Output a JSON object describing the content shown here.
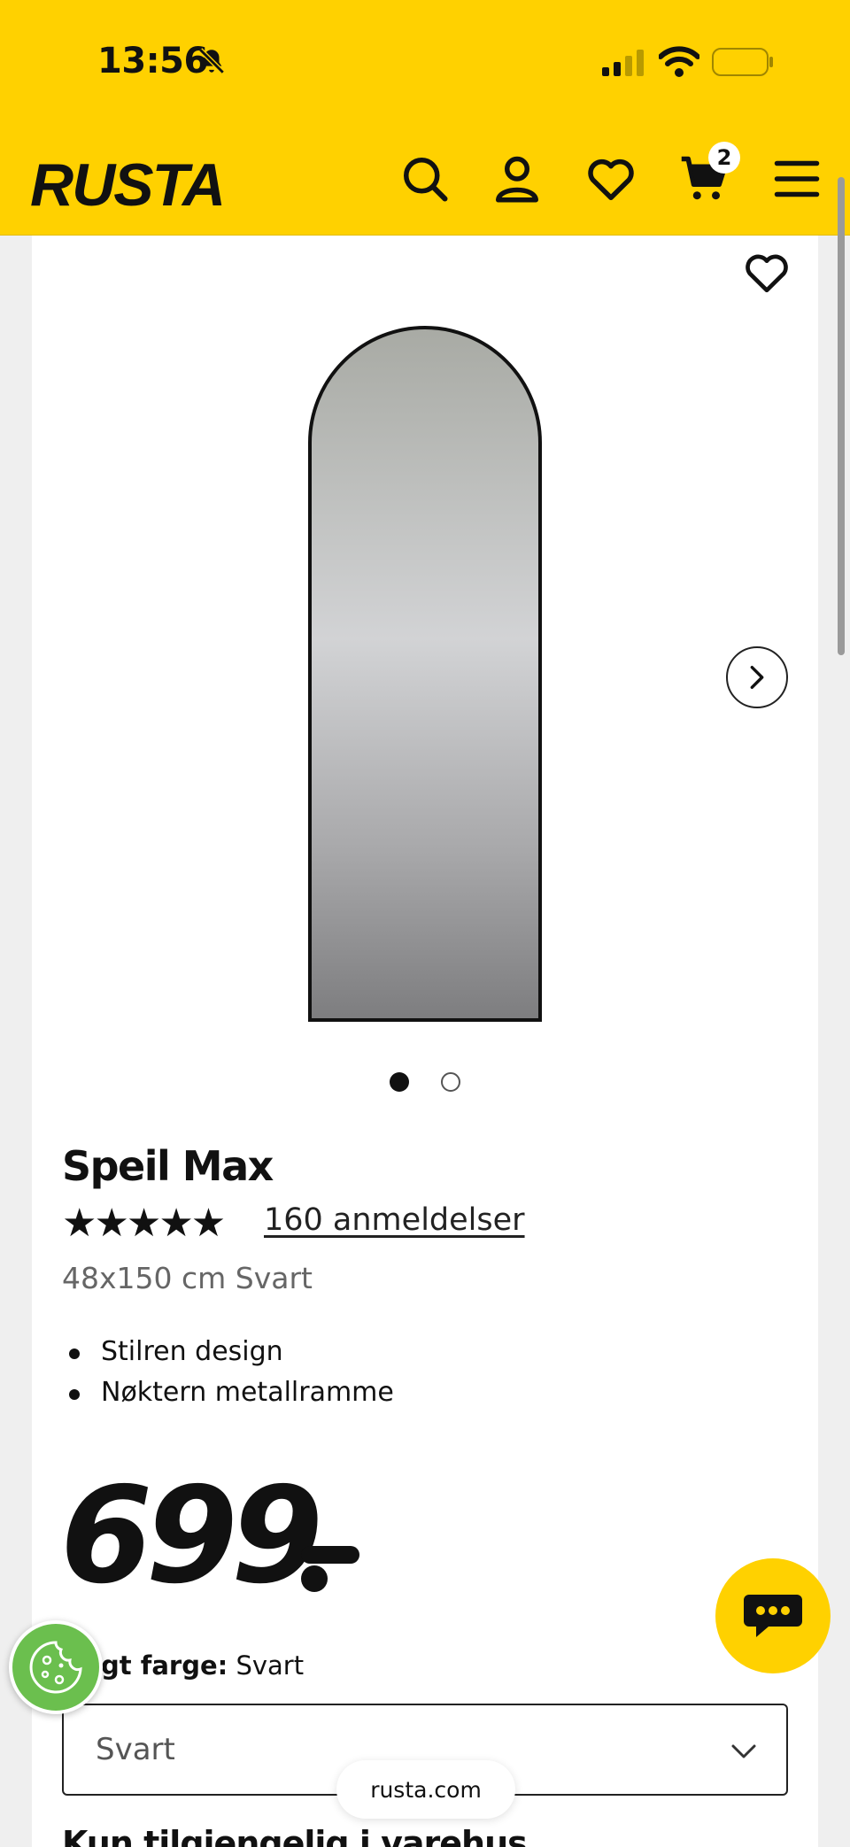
{
  "status_bar": {
    "time": "13:56",
    "icons": [
      "bell-slash-icon",
      "cellular-signal-icon",
      "wifi-icon",
      "battery-icon"
    ]
  },
  "header": {
    "brand": "RUSTA",
    "background_color": "#ffd100",
    "icons": [
      "search-icon",
      "account-icon",
      "heart-icon",
      "cart-icon",
      "menu-icon"
    ],
    "cart_count": "2"
  },
  "product": {
    "title": "Speil Max",
    "rating_stars": "★★★★★",
    "rating_value": 5,
    "reviews_label": "160 anmeldelser",
    "variant": "48x150 cm Svart",
    "features": [
      "Stilren design",
      "Nøktern metallramme"
    ],
    "price": "699",
    "gallery": {
      "total_slides": 2,
      "active_slide": 1
    }
  },
  "color_selector": {
    "label_bold": "gt farge:",
    "label_value": " Svart",
    "selected": "Svart"
  },
  "browser": {
    "url": "rusta.com"
  },
  "section_heading": "Kun tilgjengelig i varehus",
  "floating": {
    "chat_icon": "chat-bubble-icon",
    "cookie_icon": "cookie-icon"
  }
}
